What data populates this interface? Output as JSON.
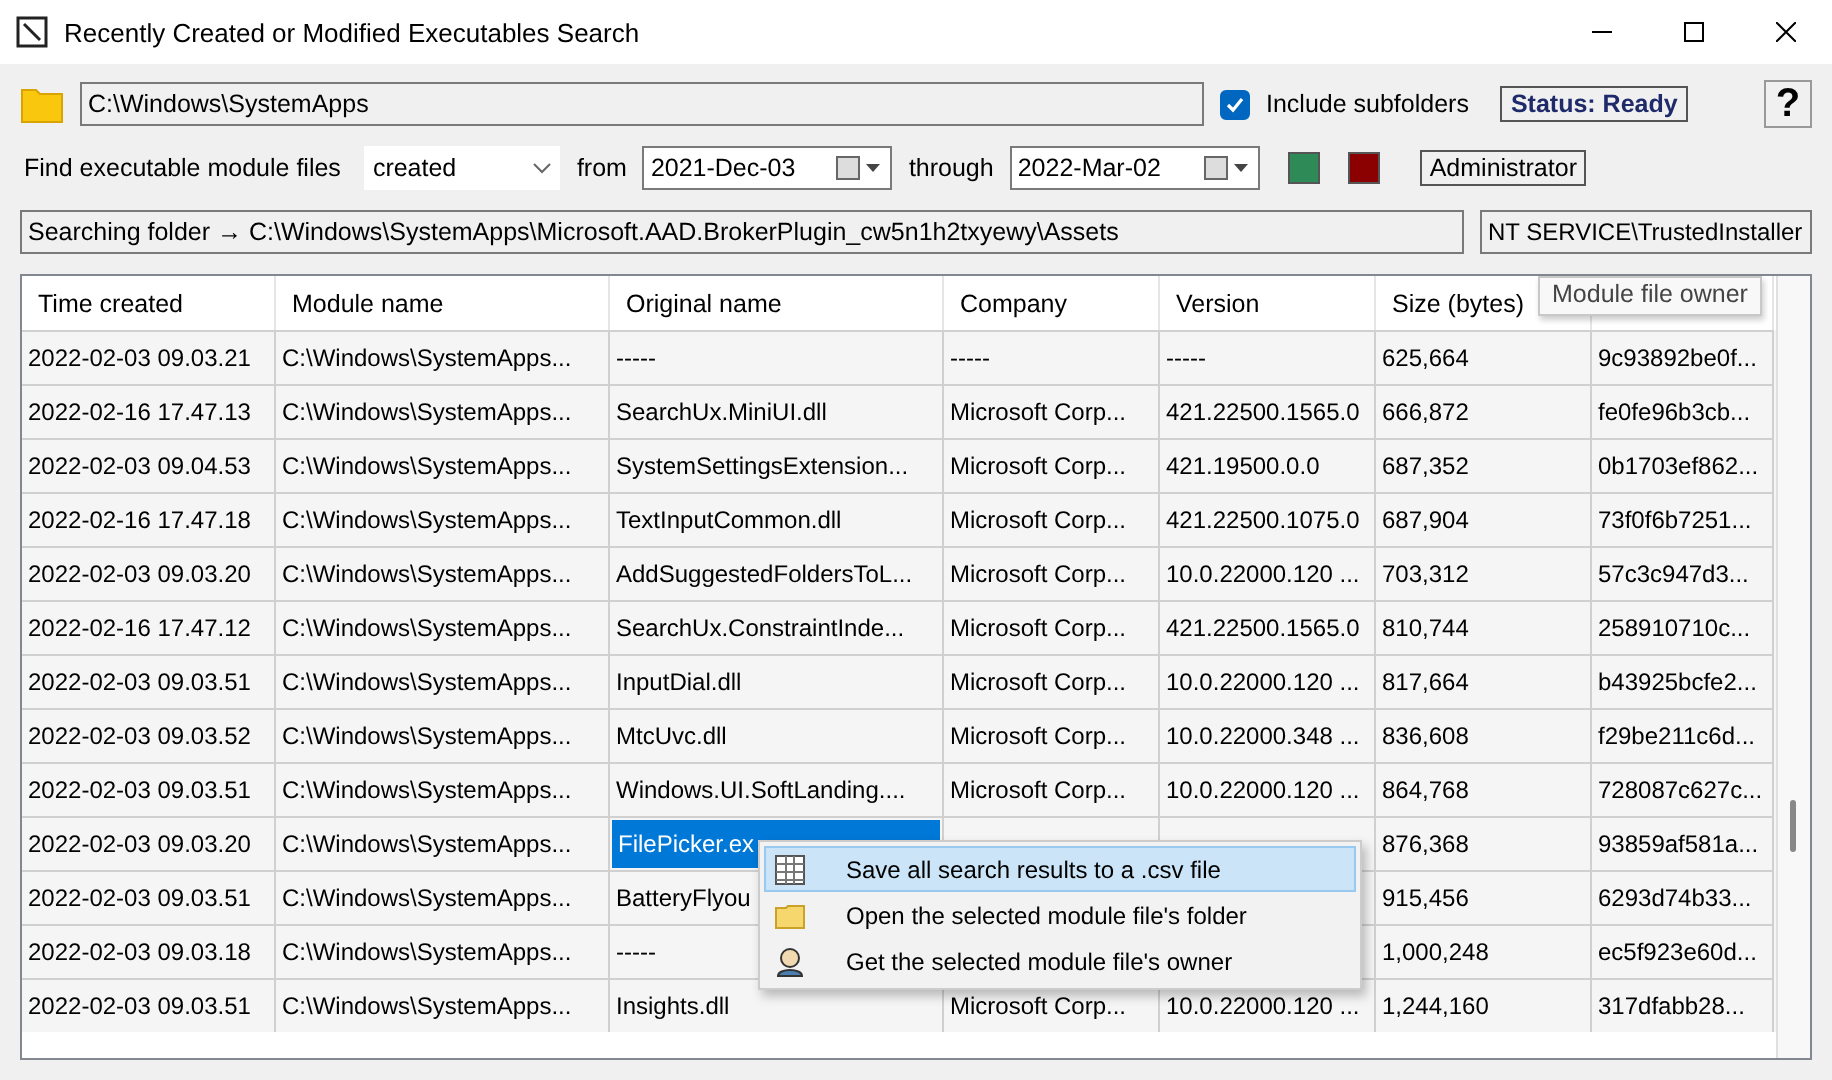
{
  "window": {
    "title": "Recently Created or Modified Executables Search"
  },
  "folder": {
    "path": "C:\\Windows\\SystemApps"
  },
  "include_subfolders": {
    "label": "Include subfolders",
    "checked": true
  },
  "status": "Status: Ready",
  "help": "?",
  "criteria": {
    "label": "Find executable module files",
    "mode": "created",
    "from_label": "from",
    "from_date": "2021-Dec-03",
    "through_label": "through",
    "through_date": "2022-Mar-02"
  },
  "user": "Administrator",
  "progress": "Searching folder → C:\\Windows\\SystemApps\\Microsoft.AAD.BrokerPlugin_cw5n1h2txyewy\\Assets",
  "owner": "NT SERVICE\\TrustedInstaller",
  "tooltip": "Module file owner",
  "table": {
    "columns": [
      "Time created",
      "Module name",
      "Original name",
      "Company",
      "Version",
      "Size (bytes)"
    ],
    "rows": [
      {
        "selected": false,
        "cells": [
          "2022-02-03 09.03.21",
          "C:\\Windows\\SystemApps...",
          "-----",
          "-----",
          "-----",
          "625,664",
          "9c93892be0f..."
        ]
      },
      {
        "selected": false,
        "cells": [
          "2022-02-16 17.47.13",
          "C:\\Windows\\SystemApps...",
          "SearchUx.MiniUI.dll",
          "Microsoft Corp...",
          "421.22500.1565.0",
          "666,872",
          "fe0fe96b3cb..."
        ]
      },
      {
        "selected": false,
        "cells": [
          "2022-02-03 09.04.53",
          "C:\\Windows\\SystemApps...",
          "SystemSettingsExtension...",
          "Microsoft Corp...",
          "421.19500.0.0",
          "687,352",
          "0b1703ef862..."
        ]
      },
      {
        "selected": false,
        "cells": [
          "2022-02-16 17.47.18",
          "C:\\Windows\\SystemApps...",
          "TextInputCommon.dll",
          "Microsoft Corp...",
          "421.22500.1075.0",
          "687,904",
          "73f0f6b7251..."
        ]
      },
      {
        "selected": false,
        "cells": [
          "2022-02-03 09.03.20",
          "C:\\Windows\\SystemApps...",
          "AddSuggestedFoldersToL...",
          "Microsoft Corp...",
          "10.0.22000.120 ...",
          "703,312",
          "57c3c947d3..."
        ]
      },
      {
        "selected": false,
        "cells": [
          "2022-02-16 17.47.12",
          "C:\\Windows\\SystemApps...",
          "SearchUx.ConstraintInde...",
          "Microsoft Corp...",
          "421.22500.1565.0",
          "810,744",
          "258910710c..."
        ]
      },
      {
        "selected": false,
        "cells": [
          "2022-02-03 09.03.51",
          "C:\\Windows\\SystemApps...",
          "InputDial.dll",
          "Microsoft Corp...",
          "10.0.22000.120 ...",
          "817,664",
          "b43925bcfe2..."
        ]
      },
      {
        "selected": false,
        "cells": [
          "2022-02-03 09.03.52",
          "C:\\Windows\\SystemApps...",
          "MtcUvc.dll",
          "Microsoft Corp...",
          "10.0.22000.348 ...",
          "836,608",
          "f29be211c6d..."
        ]
      },
      {
        "selected": false,
        "cells": [
          "2022-02-03 09.03.51",
          "C:\\Windows\\SystemApps...",
          "Windows.UI.SoftLanding....",
          "Microsoft Corp...",
          "10.0.22000.120 ...",
          "864,768",
          "728087c627c..."
        ]
      },
      {
        "selected": true,
        "cells": [
          "2022-02-03 09.03.20",
          "C:\\Windows\\SystemApps...",
          "FilePicker.ex",
          null,
          null,
          "876,368",
          "93859af581a..."
        ]
      },
      {
        "selected": false,
        "cells": [
          "2022-02-03 09.03.51",
          "C:\\Windows\\SystemApps...",
          "BatteryFlyou",
          null,
          null,
          "915,456",
          "6293d74b33..."
        ]
      },
      {
        "selected": false,
        "cells": [
          "2022-02-03 09.03.18",
          "C:\\Windows\\SystemApps...",
          "-----",
          null,
          null,
          "1,000,248",
          "ec5f923e60d..."
        ]
      },
      {
        "selected": false,
        "cells": [
          "2022-02-03 09.03.51",
          "C:\\Windows\\SystemApps...",
          "Insights.dll",
          "Microsoft Corp...",
          "10.0.22000.120 ...",
          "1,244,160",
          "317dfabb28..."
        ]
      }
    ]
  },
  "context_menu": {
    "items": [
      {
        "label": "Save all search results to a .csv file",
        "selected": true
      },
      {
        "label": "Open the selected module file's folder",
        "selected": false
      },
      {
        "label": "Get the selected module file's owner",
        "selected": false
      }
    ]
  }
}
